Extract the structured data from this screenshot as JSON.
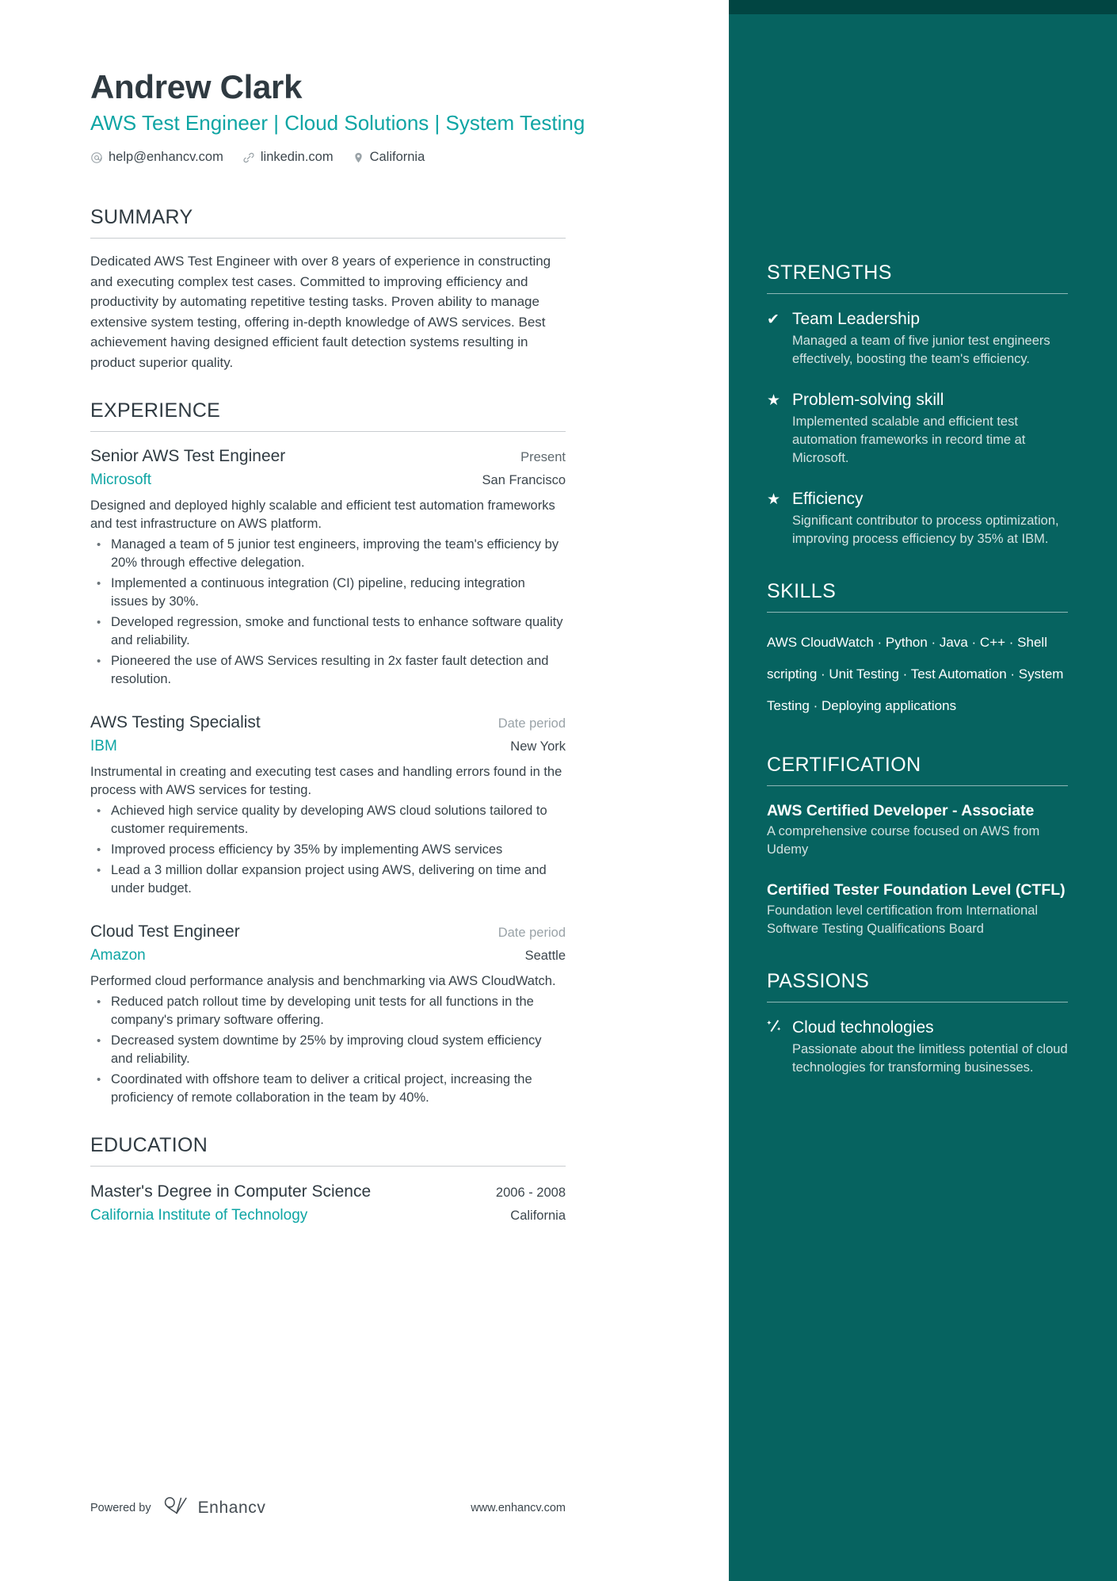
{
  "header": {
    "name": "Andrew Clark",
    "headline": "AWS Test Engineer | Cloud Solutions | System Testing",
    "contacts": [
      {
        "icon": "email-icon",
        "text": "help@enhancv.com"
      },
      {
        "icon": "link-icon",
        "text": "linkedin.com"
      },
      {
        "icon": "location-pin-icon",
        "text": "California"
      }
    ]
  },
  "summary": {
    "title": "SUMMARY",
    "text": "Dedicated AWS Test Engineer with over 8 years of experience in constructing and executing complex test cases. Committed to improving efficiency and productivity by automating repetitive testing tasks. Proven ability to manage extensive system testing, offering in-depth knowledge of AWS services. Best achievement having designed efficient fault detection systems resulting in product superior quality."
  },
  "experience": {
    "title": "EXPERIENCE",
    "jobs": [
      {
        "title": "Senior AWS Test Engineer",
        "date": "Present",
        "date_muted": false,
        "company": "Microsoft",
        "location": "San Francisco",
        "description": "Designed and deployed highly scalable and efficient test automation frameworks and test infrastructure on AWS platform.",
        "bullets": [
          "Managed a team of 5 junior test engineers, improving the team's efficiency by 20% through effective delegation.",
          "Implemented a continuous integration (CI) pipeline, reducing integration issues by 30%.",
          "Developed regression, smoke and functional tests to enhance software quality and reliability.",
          "Pioneered the use of AWS Services resulting in 2x faster fault detection and resolution."
        ]
      },
      {
        "title": "AWS Testing Specialist",
        "date": "Date period",
        "date_muted": true,
        "company": "IBM",
        "location": "New York",
        "description": "Instrumental in creating and executing test cases and handling errors found in the process with AWS services for testing.",
        "bullets": [
          "Achieved high service quality by developing AWS cloud solutions tailored to customer requirements.",
          "Improved process efficiency by 35% by implementing AWS services",
          "Lead a 3 million dollar expansion project using AWS, delivering on time and under budget."
        ]
      },
      {
        "title": "Cloud Test Engineer",
        "date": "Date period",
        "date_muted": true,
        "company": "Amazon",
        "location": "Seattle",
        "description": "Performed cloud performance analysis and benchmarking via AWS CloudWatch.",
        "bullets": [
          "Reduced patch rollout time by developing unit tests for all functions in the company's primary software offering.",
          "Decreased system downtime by 25% by improving cloud system efficiency and reliability.",
          "Coordinated with offshore team to deliver a critical project, increasing the proficiency of remote collaboration in the team by 40%."
        ]
      }
    ]
  },
  "education": {
    "title": "EDUCATION",
    "entries": [
      {
        "degree": "Master's Degree in Computer Science",
        "date": "2006 - 2008",
        "school": "California Institute of Technology",
        "location": "California"
      }
    ]
  },
  "strengths": {
    "title": "STRENGTHS",
    "items": [
      {
        "icon": "check-icon",
        "name": "Team Leadership",
        "desc": "Managed a team of five junior test engineers effectively, boosting the team's efficiency."
      },
      {
        "icon": "star-icon",
        "name": "Problem-solving skill",
        "desc": "Implemented scalable and efficient test automation frameworks in record time at Microsoft."
      },
      {
        "icon": "star-icon",
        "name": "Efficiency",
        "desc": "Significant contributor to process optimization, improving process efficiency by 35% at IBM."
      }
    ]
  },
  "skills": {
    "title": "SKILLS",
    "text": "AWS CloudWatch · Python · Java · C++ · Shell scripting · Unit Testing · Test Automation · System Testing · Deploying applications",
    "list": [
      "AWS CloudWatch",
      "Python",
      "Java",
      "C++",
      "Shell scripting",
      "Unit Testing",
      "Test Automation",
      "System Testing",
      "Deploying applications"
    ]
  },
  "certification": {
    "title": "CERTIFICATION",
    "items": [
      {
        "name": "AWS Certified Developer - Associate",
        "desc": "A comprehensive course focused on AWS from Udemy"
      },
      {
        "name": "Certified Tester Foundation Level (CTFL)",
        "desc": "Foundation level certification from International Software Testing Qualifications Board"
      }
    ]
  },
  "passions": {
    "title": "PASSIONS",
    "items": [
      {
        "icon": "sparkle-slash-icon",
        "name": "Cloud technologies",
        "desc": "Passionate about the limitless potential of cloud technologies for transforming businesses."
      }
    ]
  },
  "footer": {
    "powered_by": "Powered by",
    "brand": "Enhancv",
    "url": "www.enhancv.com"
  },
  "colors": {
    "accent_teal": "#0ea5a4",
    "sidebar_bg": "#066360",
    "sidebar_top_strip": "#014542",
    "ink": "#2f3a41"
  }
}
